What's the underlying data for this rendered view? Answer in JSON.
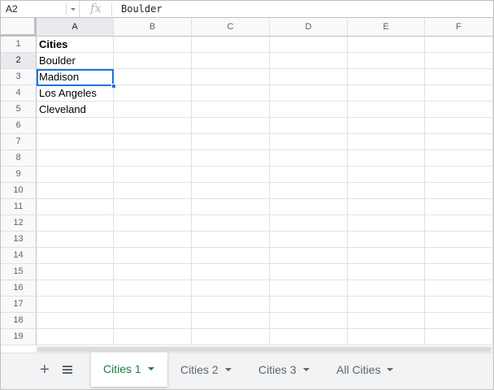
{
  "formula_bar": {
    "name_box": "A2",
    "fx_label": "fx",
    "value": "Boulder"
  },
  "columns": [
    "A",
    "B",
    "C",
    "D",
    "E",
    "F"
  ],
  "rows": [
    "1",
    "2",
    "3",
    "4",
    "5",
    "6",
    "7",
    "8",
    "9",
    "10",
    "11",
    "12",
    "13",
    "14",
    "15",
    "16",
    "17",
    "18",
    "19"
  ],
  "cells": {
    "A1": "Cities",
    "A2": "Boulder",
    "A3": "Madison",
    "A4": "Los Angeles",
    "A5": "Cleveland"
  },
  "selected_cell": "A2",
  "sheet_tabs": {
    "add_label": "+",
    "tabs": [
      {
        "label": "Cities 1",
        "active": true
      },
      {
        "label": "Cities 2",
        "active": false
      },
      {
        "label": "Cities 3",
        "active": false
      },
      {
        "label": "All Cities",
        "active": false
      }
    ]
  },
  "colors": {
    "accent": "#1a73e8",
    "active_tab_text": "#188038"
  }
}
